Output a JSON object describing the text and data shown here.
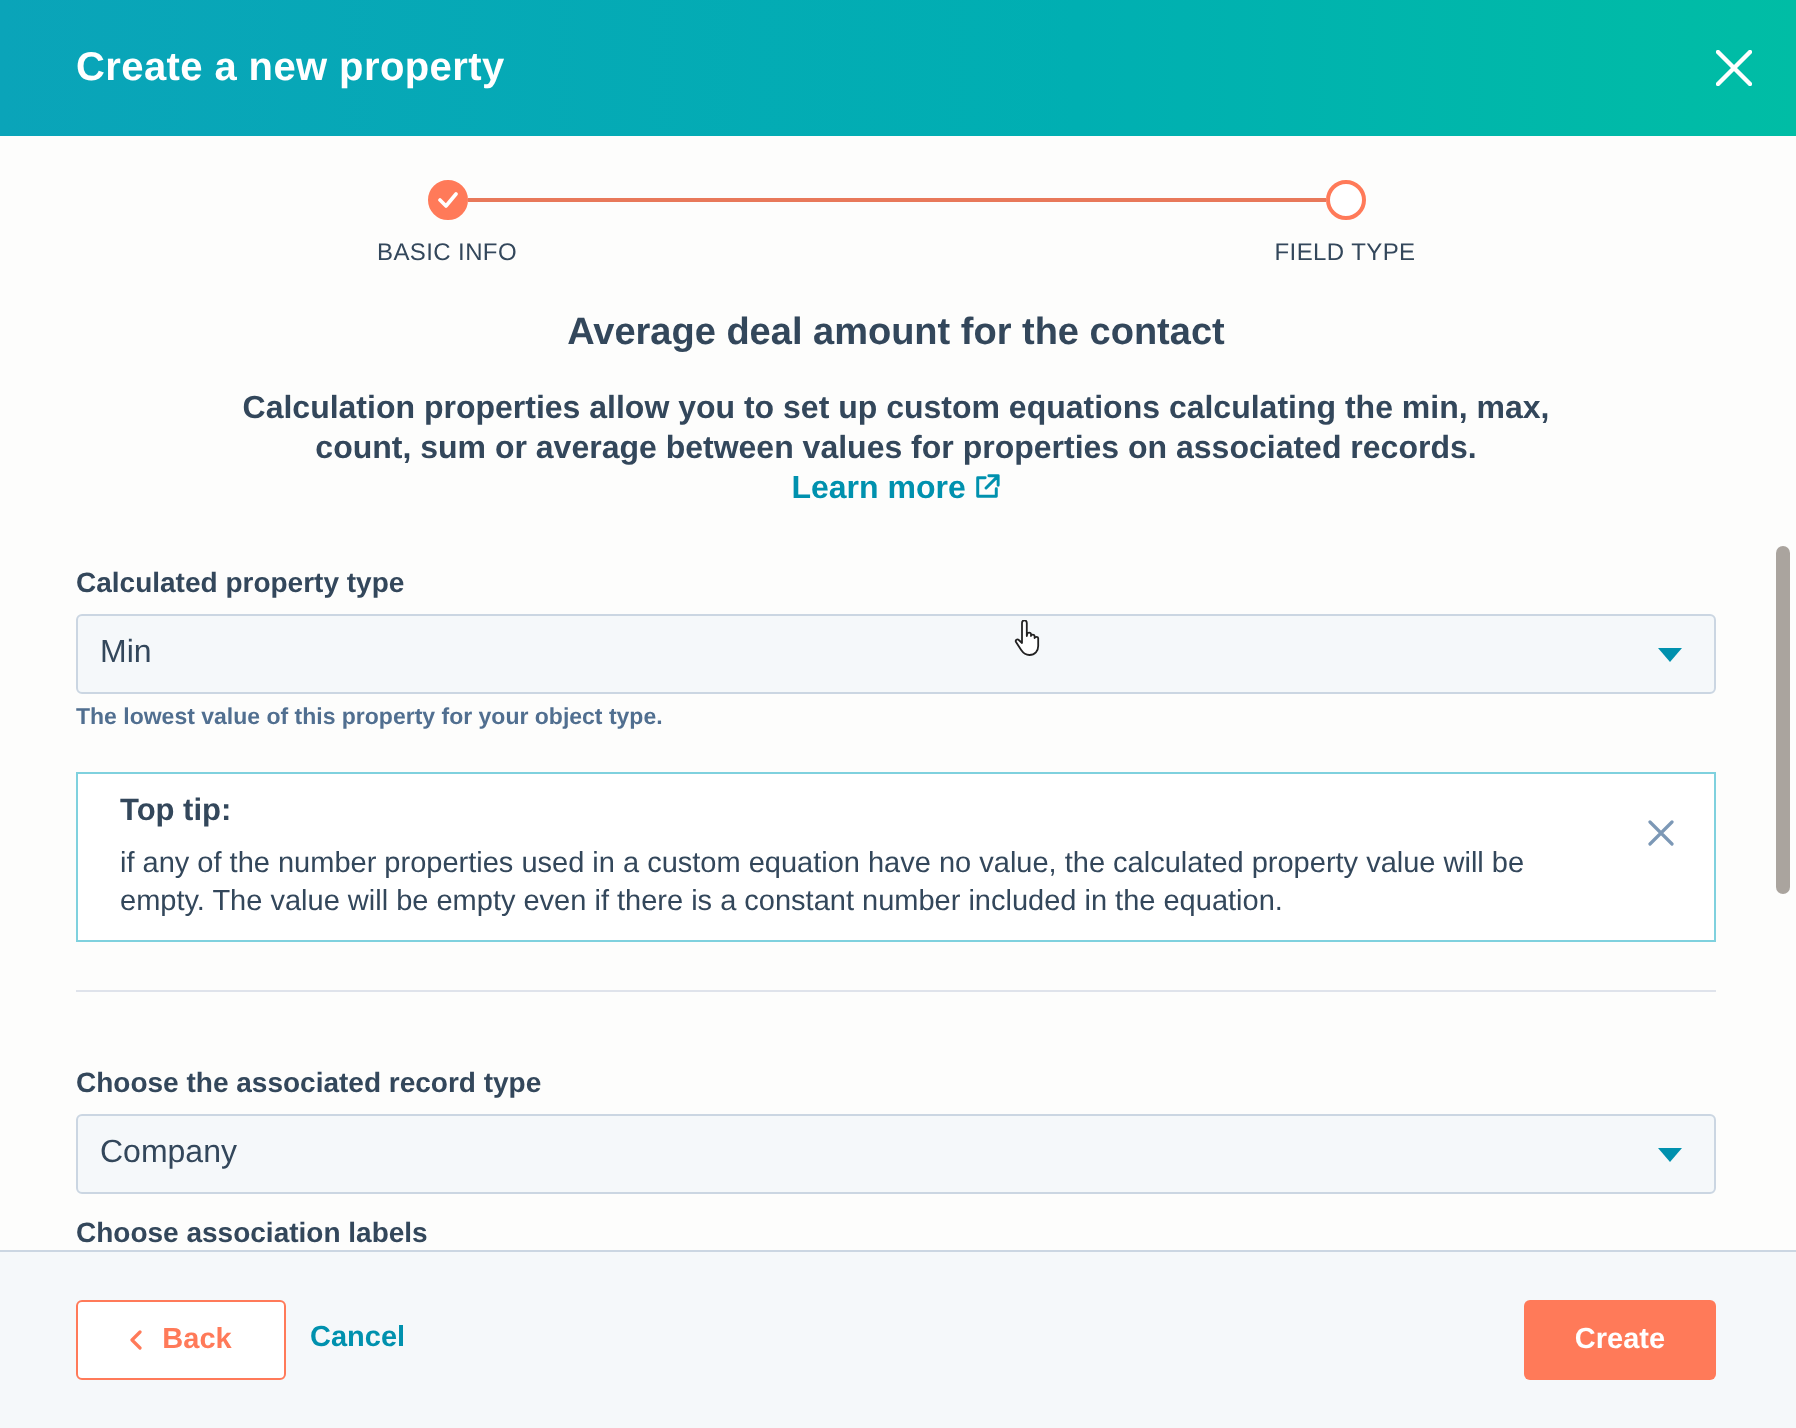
{
  "dialog": {
    "title": "Create a new property"
  },
  "stepper": {
    "steps": [
      {
        "label": "BASIC INFO",
        "completed": true
      },
      {
        "label": "FIELD TYPE",
        "completed": false
      }
    ]
  },
  "heading": "Average deal amount for the contact",
  "description": {
    "text": "Calculation properties allow you to set up custom equations calculating the min, max, count, sum or average between values for properties on associated records.",
    "link": "Learn more"
  },
  "property_type": {
    "label": "Calculated property type",
    "value": "Min",
    "help": "The lowest value of this property for your object type."
  },
  "tip": {
    "title": "Top tip:",
    "text": "if any of the number properties used in a custom equation have no value, the calculated property value will be empty. The value will be empty even if there is a constant number included in the equation."
  },
  "record_type": {
    "label": "Choose the associated record type",
    "value": "Company"
  },
  "association_labels": {
    "label": "Choose association labels"
  },
  "footer": {
    "back": "Back",
    "cancel": "Cancel",
    "create": "Create"
  }
}
